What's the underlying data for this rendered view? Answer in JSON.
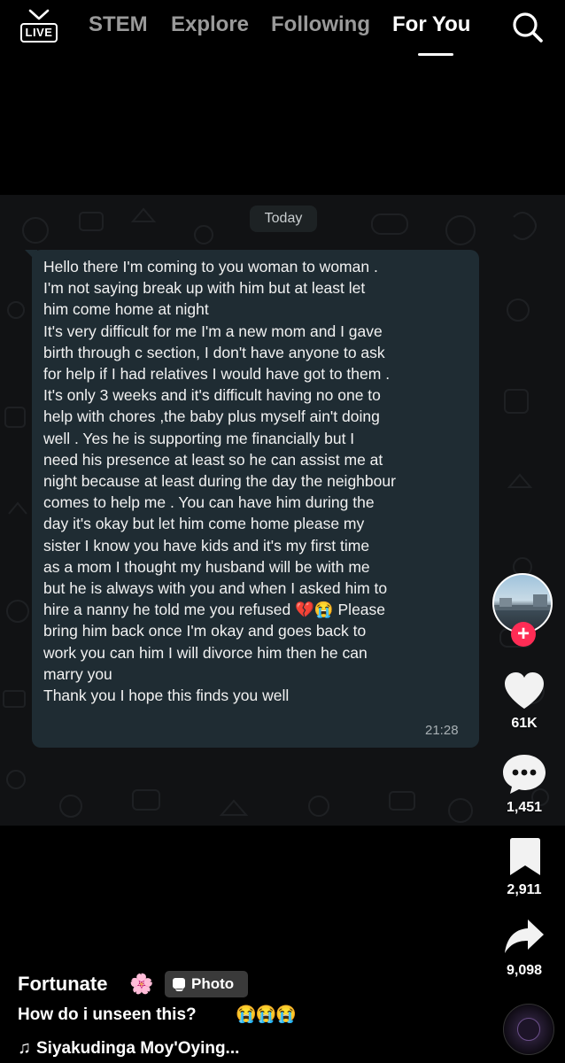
{
  "topnav": {
    "live_label": "LIVE",
    "tabs": [
      {
        "label": "STEM",
        "active": false
      },
      {
        "label": "Explore",
        "active": false
      },
      {
        "label": "Following",
        "active": false
      },
      {
        "label": "For You",
        "active": true
      }
    ],
    "search_icon": "search-icon"
  },
  "chat": {
    "date_label": "Today",
    "message": "Hello there I'm coming to you woman to woman .\nI'm not saying break up with him but at least let\nhim come home at night\nIt's very difficult for me I'm a new mom and I gave\nbirth through c section, I don't have anyone to ask\nfor help if I had relatives I would have got to them .\nIt's only 3 weeks and it's difficult having no one to\nhelp with chores ,the baby plus myself ain't doing\nwell . Yes he is supporting me financially but I\nneed his presence at least so he can assist me at\nnight because at least during the day the neighbour\ncomes to help me . You can have him during the\nday it's okay but let him come home please my\nsister I know you have kids and it's my first time\nas a mom I thought my husband will be with me\nbut he is always with you and when I asked him to\nhire a nanny he told me you refused 💔😭 Please\nbring him back once I'm okay and goes back to\nwork you can him I will divorce him then he can\nmarry you\nThank you I hope this finds you well",
    "time": "21:28"
  },
  "rail": {
    "likes": "61K",
    "comments": "1,451",
    "saves": "2,911",
    "shares": "9,098",
    "accent_color": "#fe2c55"
  },
  "post": {
    "username": "Fortunate",
    "username_emoji": "🌸",
    "badge_label": "Photo",
    "caption": "How do i unseen this?",
    "caption_emoji": "😭😭😭",
    "music": "Siyakudinga Moy'Oying..."
  }
}
